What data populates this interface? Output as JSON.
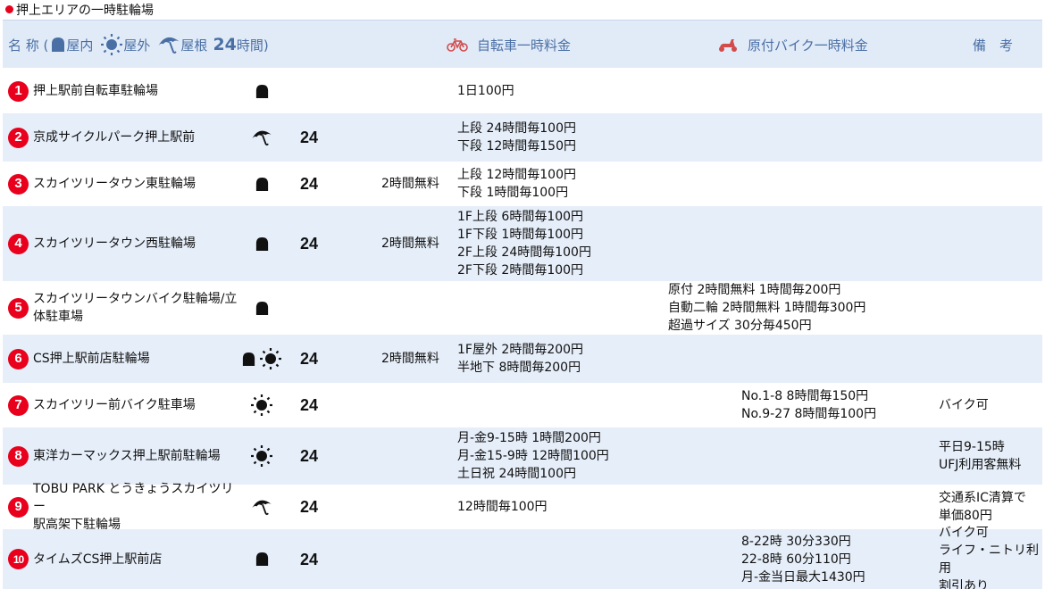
{
  "caption": "押上エリアの一時駐輪場",
  "header": {
    "name_label": "名 称 (",
    "indoor_label": "屋内",
    "outdoor_label": "屋外",
    "roof_label": "屋根",
    "hours_24": "24",
    "hours_label": "時間)",
    "bike_label": "自転車一時料金",
    "moto_label": "原付バイク一時料金",
    "note_label": "備　考"
  },
  "colors": {
    "header_bg": "#e1ebf8",
    "alt_row_bg": "#e6eef9",
    "header_text": "#4a6fa5",
    "badge": "#e8001c"
  },
  "rows": [
    {
      "no": "1",
      "name": [
        "押上駅前自転車駐輪場"
      ],
      "icons": [
        "indoor-icon"
      ],
      "h24": "",
      "free": "",
      "bike": [
        "1日100円"
      ],
      "moto": [],
      "note": []
    },
    {
      "no": "2",
      "name": [
        "京成サイクルパーク押上駅前"
      ],
      "icons": [
        "roof-icon"
      ],
      "h24": "24",
      "free": "",
      "bike": [
        "上段 24時間毎100円",
        "下段 12時間毎150円"
      ],
      "moto": [],
      "note": []
    },
    {
      "no": "3",
      "name": [
        "スカイツリータウン東駐輪場"
      ],
      "icons": [
        "indoor-icon"
      ],
      "h24": "24",
      "free": "2時間無料",
      "bike": [
        "上段 12時間毎100円",
        "下段 1時間毎100円"
      ],
      "moto": [],
      "note": []
    },
    {
      "no": "4",
      "name": [
        "スカイツリータウン西駐輪場"
      ],
      "icons": [
        "indoor-icon"
      ],
      "h24": "24",
      "free": "2時間無料",
      "bike": [
        "1F上段 6時間毎100円",
        "1F下段 1時間毎100円",
        "2F上段 24時間毎100円",
        "2F下段 2時間毎100円"
      ],
      "moto": [],
      "note": []
    },
    {
      "no": "5",
      "name": [
        "スカイツリータウンバイク駐輪場/立",
        "体駐車場"
      ],
      "icons": [
        "indoor-icon"
      ],
      "h24": "",
      "free": "",
      "bike": [],
      "moto": [
        "原付 2時間無料 1時間毎200円",
        "自動二輪 2時間無料 1時間毎300円",
        "超過サイズ 30分毎450円"
      ],
      "note": []
    },
    {
      "no": "6",
      "name": [
        "CS押上駅前店駐輪場"
      ],
      "icons": [
        "indoor-icon",
        "sun-icon"
      ],
      "h24": "24",
      "free": "2時間無料",
      "bike": [
        "1F屋外 2時間毎200円",
        "半地下 8時間毎200円"
      ],
      "moto": [],
      "note": []
    },
    {
      "no": "7",
      "name": [
        "スカイツリー前バイク駐車場"
      ],
      "icons": [
        "sun-icon"
      ],
      "h24": "24",
      "free": "",
      "bike": [],
      "moto": [
        "No.1-8 8時間毎150円",
        "No.9-27 8時間毎100円"
      ],
      "note": [
        "バイク可"
      ]
    },
    {
      "no": "8",
      "name": [
        "東洋カーマックス押上駅前駐輪場"
      ],
      "icons": [
        "sun-icon"
      ],
      "h24": "24",
      "free": "",
      "bike": [
        "月-金9-15時 1時間200円",
        "月-金15-9時 12時間100円",
        "土日祝 24時間100円"
      ],
      "moto": [],
      "note": [
        "平日9-15時",
        "UFJ利用客無料"
      ]
    },
    {
      "no": "9",
      "name": [
        "TOBU PARK とうきょうスカイツリー",
        "駅高架下駐輪場"
      ],
      "icons": [
        "roof-icon"
      ],
      "h24": "24",
      "free": "",
      "bike": [
        "12時間毎100円"
      ],
      "moto": [],
      "note": [
        "交通系IC清算で",
        "単価80円"
      ]
    },
    {
      "no": "10",
      "name": [
        "タイムズCS押上駅前店"
      ],
      "icons": [
        "indoor-icon"
      ],
      "h24": "24",
      "free": "",
      "bike": [],
      "moto": [
        "8-22時 30分330円",
        "22-8時 60分110円",
        "月-金当日最大1430円"
      ],
      "note": [
        "バイク可",
        "ライフ・ニトリ利用",
        "割引あり"
      ]
    }
  ]
}
